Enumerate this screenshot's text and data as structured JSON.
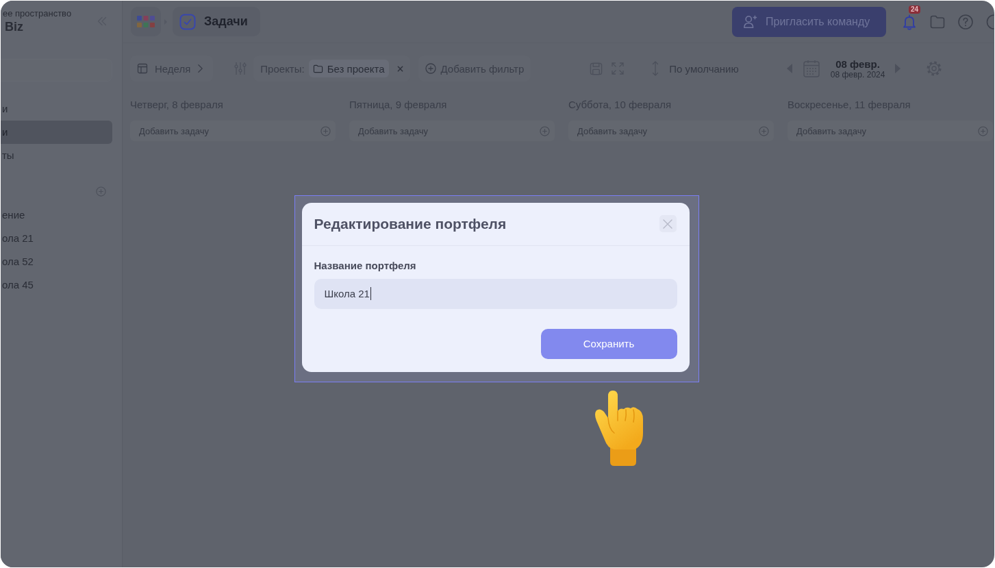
{
  "workspace": {
    "caption": "ее пространство",
    "name": "Biz"
  },
  "sidebar": {
    "items": [
      {
        "label": "и",
        "selected": false
      },
      {
        "label": "и",
        "selected": true
      },
      {
        "label": "ты",
        "selected": false
      }
    ],
    "section_items": [
      {
        "label": "ение",
        "selected": false
      },
      {
        "label": "ола 21",
        "selected": false
      },
      {
        "label": "ола 52",
        "selected": false
      },
      {
        "label": "ола 45",
        "selected": false
      }
    ]
  },
  "breadcrumb": {
    "current": "Задачи"
  },
  "header": {
    "invite_button": "Пригласить команду",
    "notification_count": "24"
  },
  "toolbar": {
    "view": "Неделя",
    "filter_label": "Проекты:",
    "filter_value": "Без проекта",
    "add_filter": "Добавить фильтр",
    "sort": "По умолчанию",
    "date": "08 февр.",
    "date_full": "08 февр. 2024"
  },
  "days": [
    {
      "title": "Четверг, 8 февраля",
      "placeholder": "Добавить задачу"
    },
    {
      "title": "Пятница, 9 февраля",
      "placeholder": "Добавить задачу"
    },
    {
      "title": "Суббота, 10 февраля",
      "placeholder": "Добавить задачу"
    },
    {
      "title": "Воскресенье, 11 февраля",
      "placeholder": "Добавить задачу"
    }
  ],
  "dialog": {
    "title": "Редактирование портфеля",
    "field_label": "Название портфеля",
    "field_value": "Школа 21",
    "save_button": "Сохранить"
  }
}
